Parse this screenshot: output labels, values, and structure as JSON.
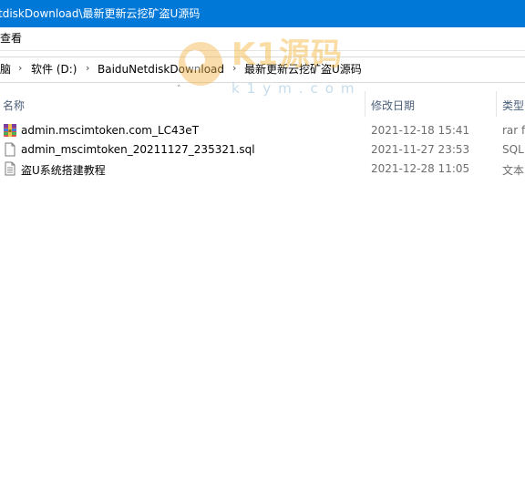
{
  "window": {
    "title": "tdiskDownload\\最新更新云挖矿盗U源码"
  },
  "ribbon": {
    "view_tab": "查看"
  },
  "address": {
    "crumbs": [
      "脑",
      "软件 (D:)",
      "BaiduNetdiskDownload",
      "最新更新云挖矿盗U源码"
    ]
  },
  "columns": {
    "name": "名称",
    "date": "修改日期",
    "type": "类型"
  },
  "files": [
    {
      "name": "admin.mscimtoken.com_LC43eT",
      "date": "2021-12-18 15:41",
      "type": "rar f",
      "icon": "rar-archive-icon"
    },
    {
      "name": "admin_mscimtoken_20211127_235321.sql",
      "date": "2021-11-27 23:53",
      "type": "SQL",
      "icon": "document-icon"
    },
    {
      "name": "盗U系统搭建教程",
      "date": "2021-12-28 11:05",
      "type": "文本",
      "icon": "text-file-icon"
    }
  ],
  "watermark": {
    "brand": "K1源码",
    "url": "k1ym.com"
  },
  "colors": {
    "titlebar": "#0078d7",
    "header_text": "#4c607a",
    "secondary_text": "#6d6d6d"
  }
}
